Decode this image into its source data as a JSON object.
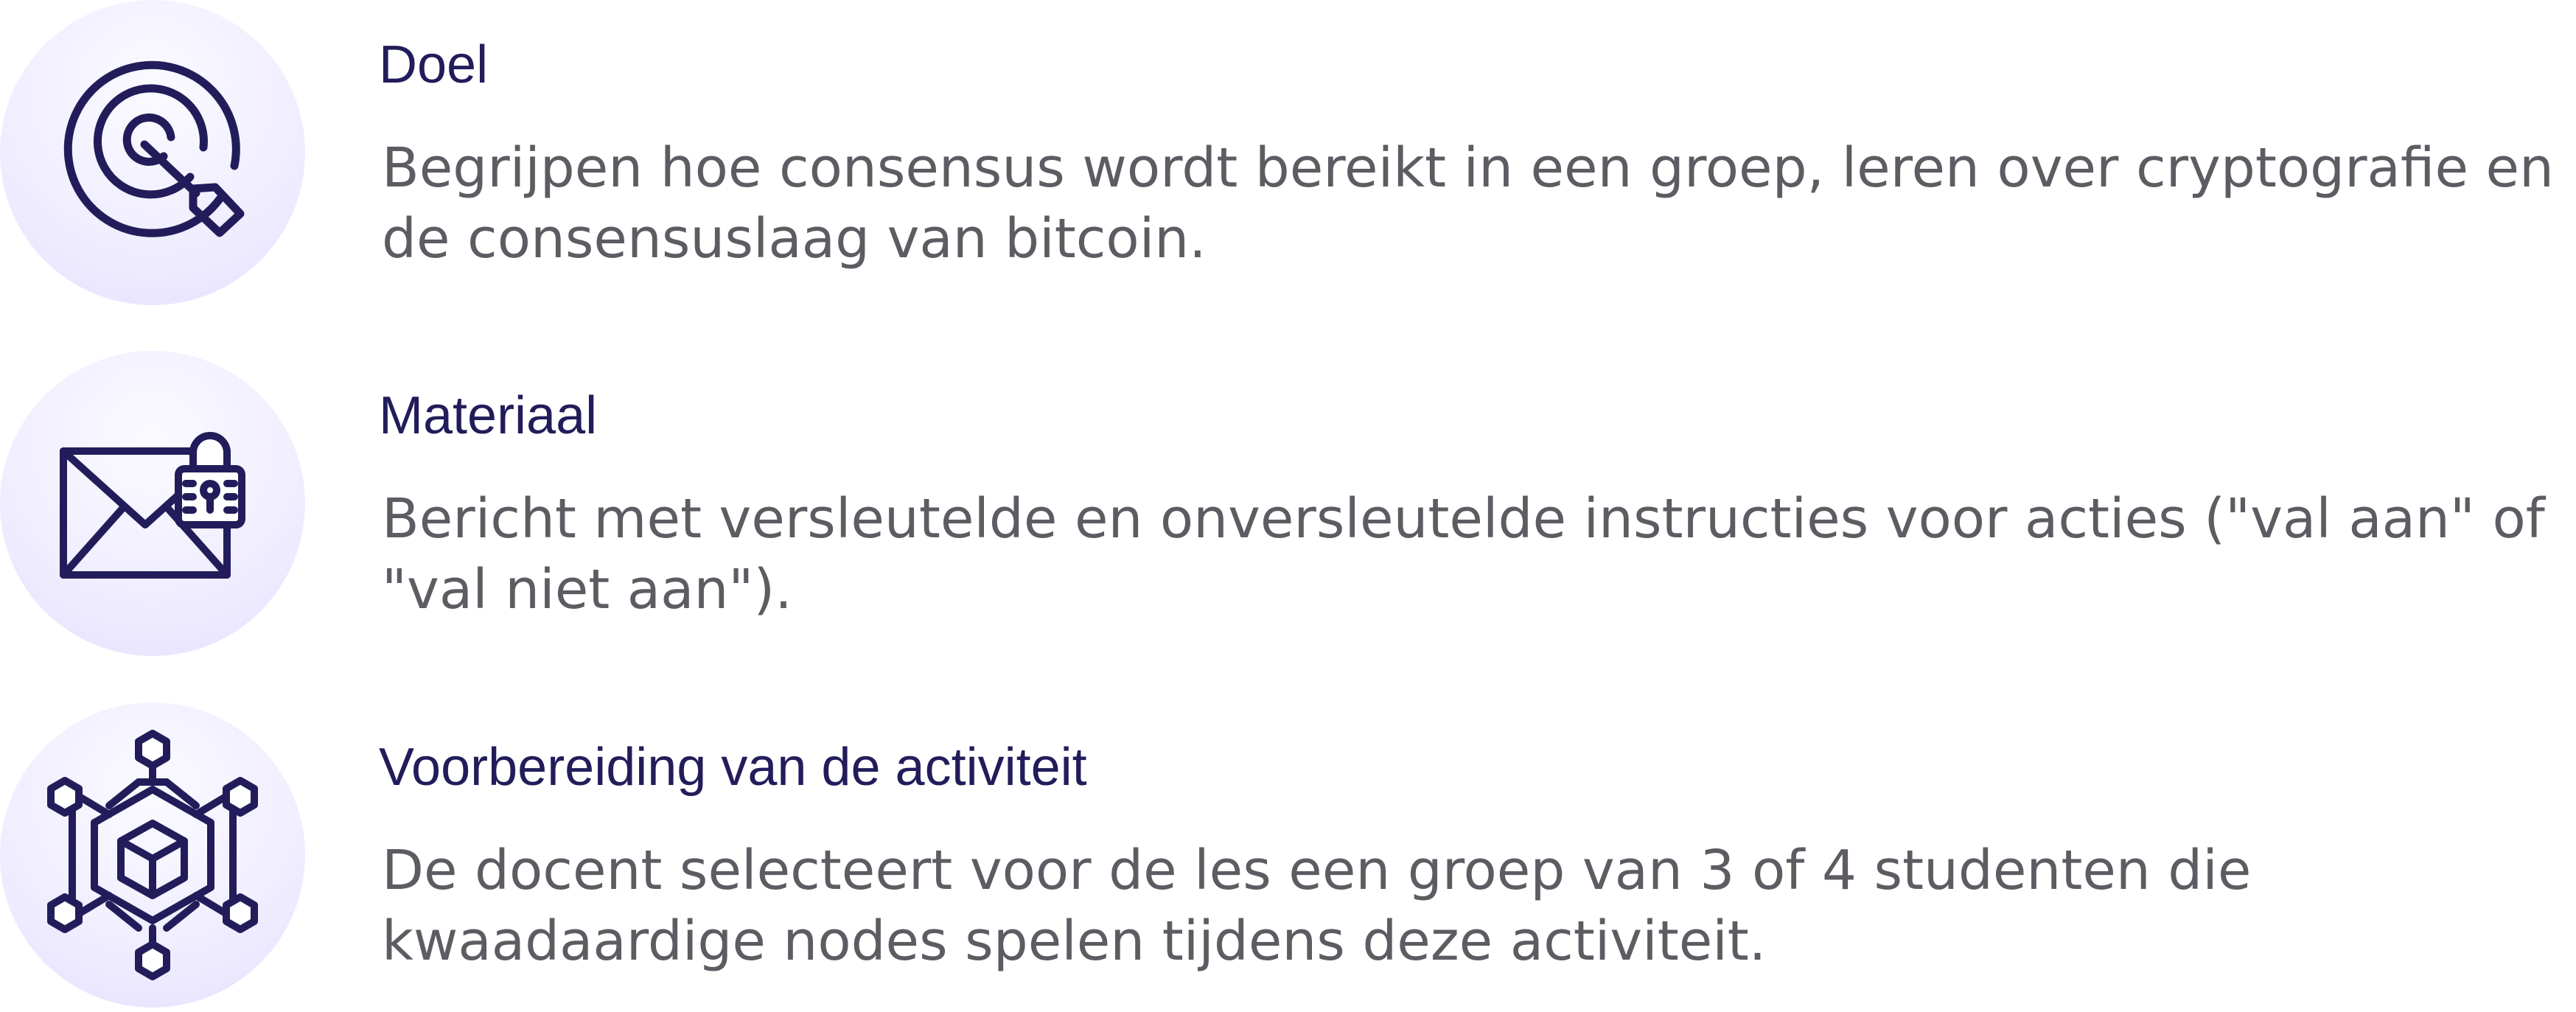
{
  "items": [
    {
      "icon": "target-icon",
      "title": "Doel",
      "text": "Begrijpen hoe consensus wordt bereikt in een groep, leren over cryptografie en de consensuslaag van bitcoin."
    },
    {
      "icon": "encrypted-mail-icon",
      "title": "Materiaal",
      "text": "Bericht met versleutelde en onversleutelde instructies voor acties (\"val aan\" of \"val niet aan\")."
    },
    {
      "icon": "network-icon",
      "title": "Voorbereiding van de activiteit",
      "text": "De docent selecteert voor de les een groep van 3 of 4 studenten die kwaadaardige nodes spelen tijdens deze activiteit."
    }
  ],
  "colors": {
    "icon_stroke": "#221d5a",
    "title": "#221d5a",
    "body_text": "#5c5c62",
    "circle_light": "#f8f6ff",
    "circle_dark": "#e6e0ff"
  }
}
